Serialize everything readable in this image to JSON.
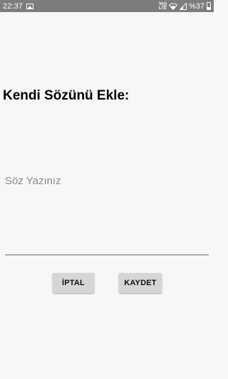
{
  "status_bar": {
    "time": "22:37",
    "network_label": "Vo)) LTE",
    "battery": "%37",
    "icons": [
      "gallery-icon",
      "volte-icon",
      "wifi-icon",
      "signal-icon",
      "battery-icon"
    ]
  },
  "page": {
    "title": "Kendi Sözünü Ekle:"
  },
  "lyric_input": {
    "value": "",
    "placeholder": "Söz Yazınız"
  },
  "buttons": {
    "cancel_label": "İPTAL",
    "save_label": "KAYDET"
  },
  "colors": {
    "status_bar_bg": "#7d7d7d",
    "background": "#f7f7f7",
    "button_bg": "#d6d6d6",
    "underline": "#6b6b6b"
  }
}
